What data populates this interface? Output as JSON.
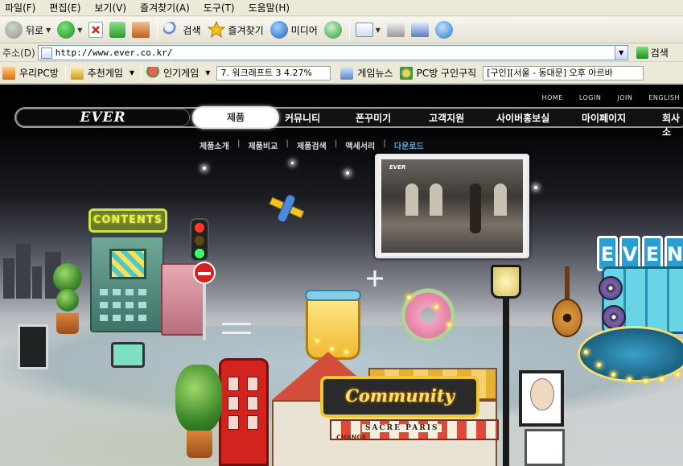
{
  "menubar": {
    "items": [
      "파일(F)",
      "편집(E)",
      "보기(V)",
      "즐겨찾기(A)",
      "도구(T)",
      "도움말(H)"
    ]
  },
  "toolbar": {
    "back_label": "뒤로",
    "search_label": "검색",
    "favorites_label": "즐겨찾기",
    "media_label": "미디어"
  },
  "address": {
    "label": "주소(D)",
    "url": "http://www.ever.co.kr/",
    "go_label": "검색"
  },
  "links": {
    "items": [
      "우리PC방",
      "추천게임",
      "인기게임"
    ],
    "ticker_text": "7. 워크래프트 3 4.27%",
    "game_news": "게임뉴스",
    "pcbang_jobs": "PC방 구인구직",
    "jobs_ticker": "[구인][서울 - 동대문] 오후 아르바"
  },
  "site": {
    "logo_text": "EVER",
    "top_links": [
      "HOME",
      "LOGIN",
      "JOIN",
      "ENGLISH"
    ],
    "nav": [
      "제품",
      "커뮤니티",
      "폰꾸미기",
      "고객지원",
      "사이버홍보실",
      "마이페이지",
      "회사소"
    ],
    "active_nav": "제품",
    "subnav": [
      "제품소개",
      "제품비교",
      "제품검색",
      "액세서리",
      "다운로드"
    ],
    "contents_sign": "CONTENTS",
    "community_sign": "Community",
    "cafe_text": "SACRE PARIS",
    "change_text": "CHANGE",
    "ever_sign": [
      "E",
      "V",
      "E",
      "N"
    ]
  },
  "colors": {
    "accent_download": "#4aaee8",
    "chrome_bg": "#ece9d8"
  }
}
